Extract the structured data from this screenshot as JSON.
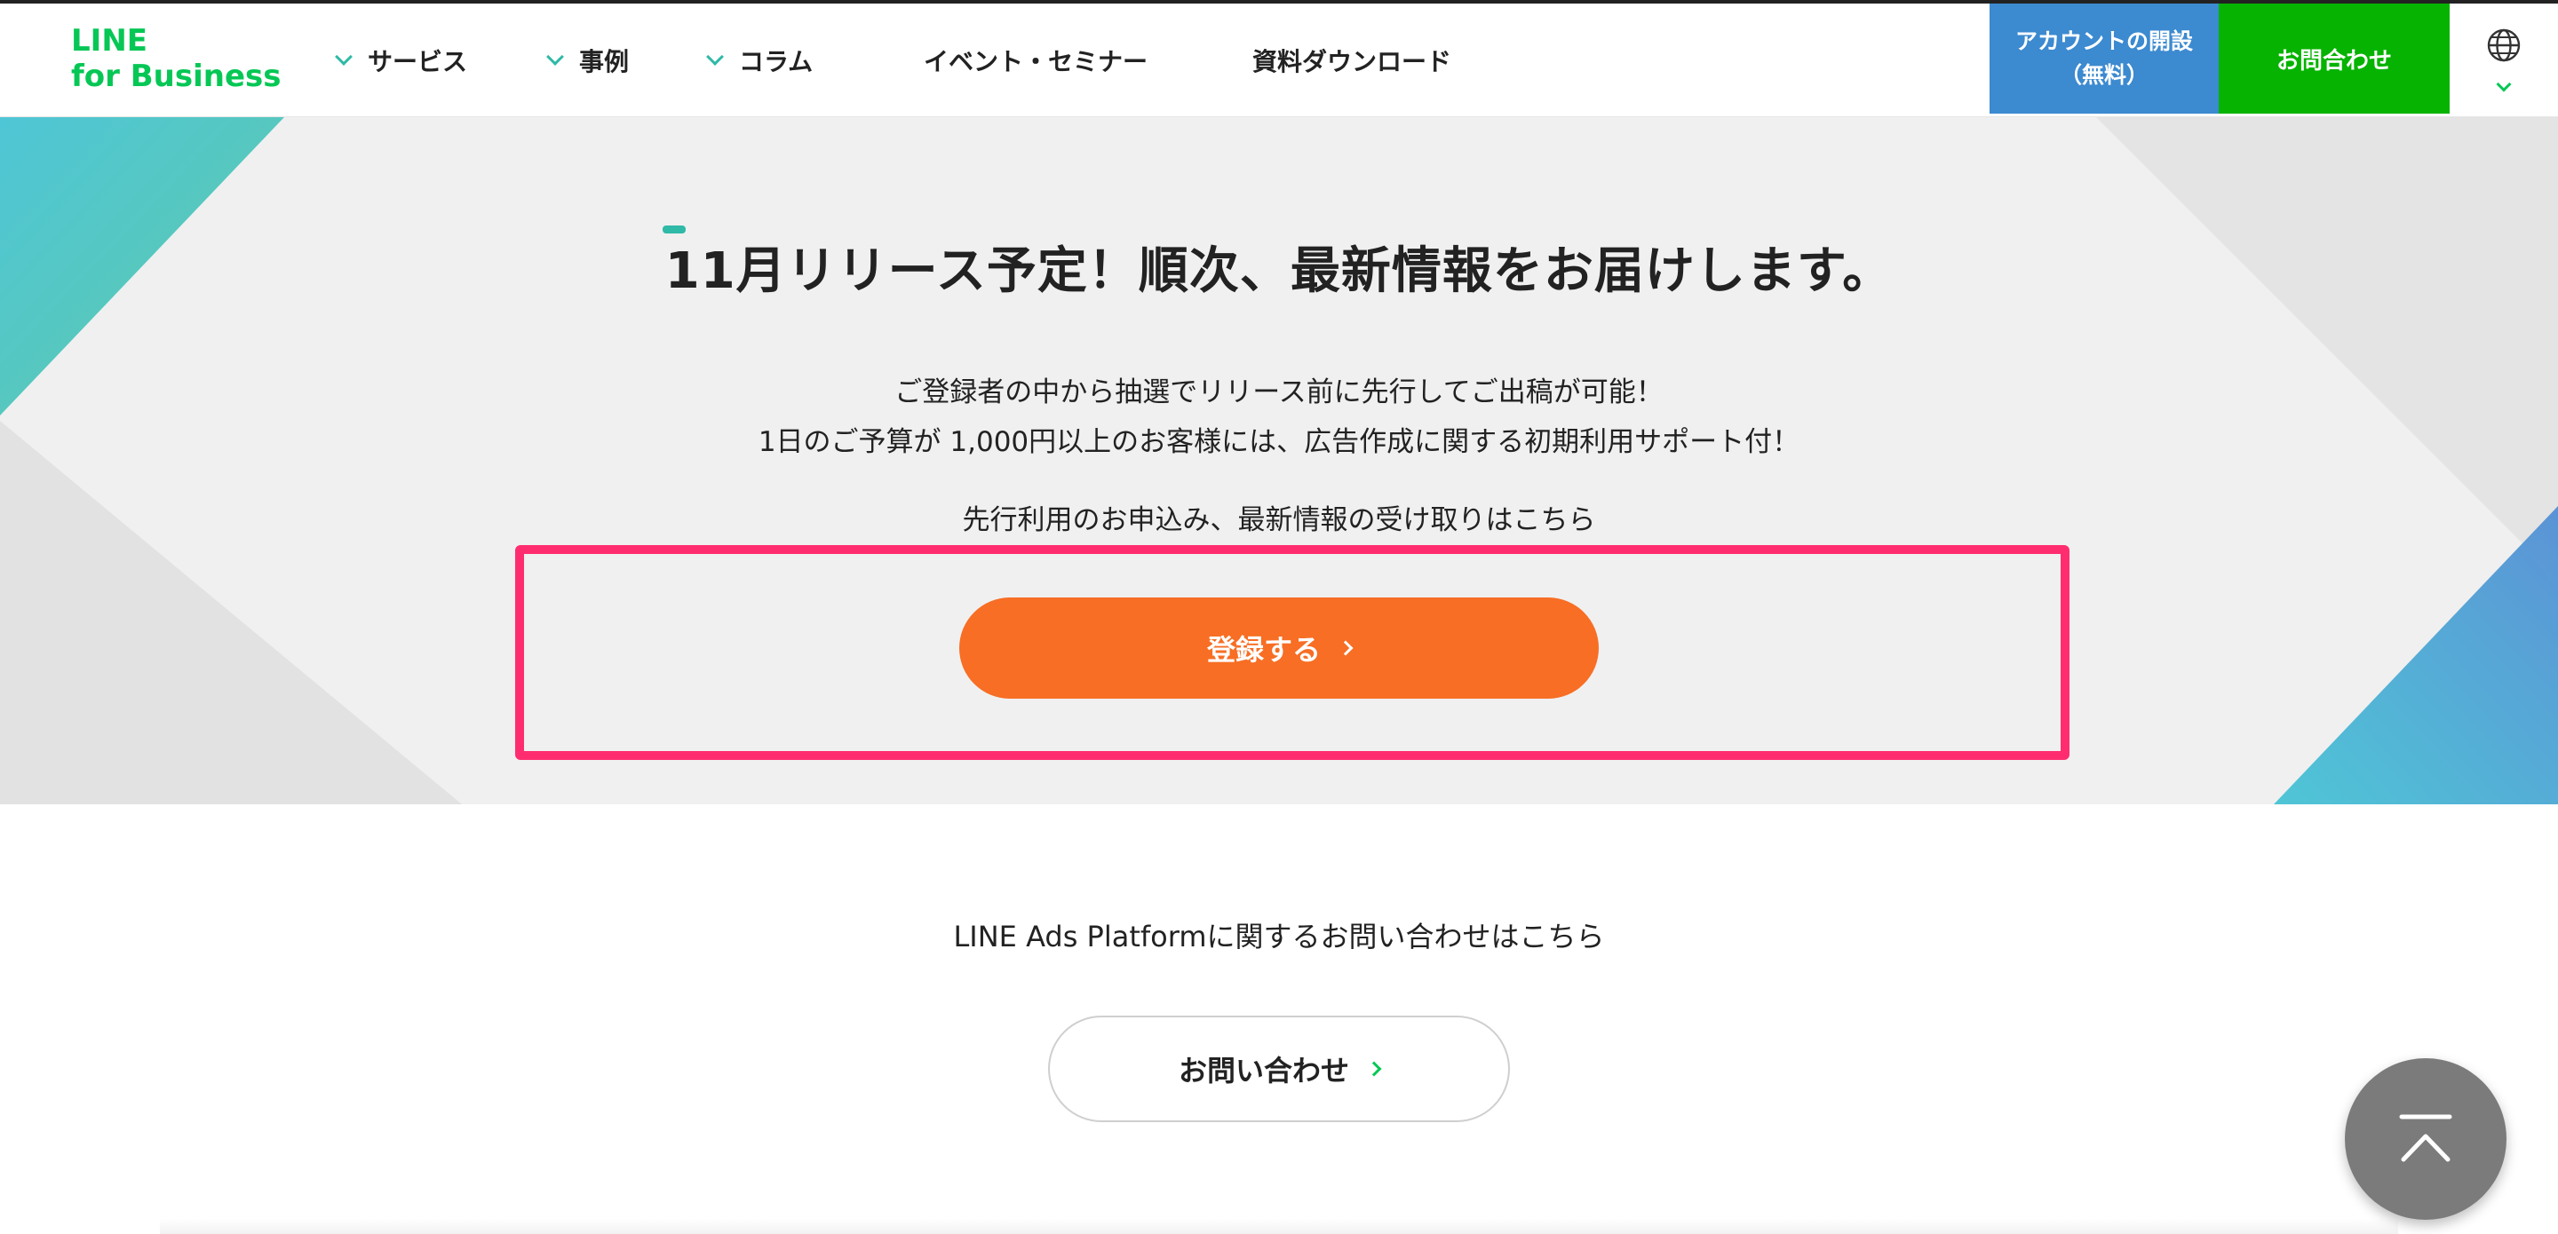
{
  "header": {
    "logo_line1": "LINE",
    "logo_line2": "for Business",
    "nav": [
      {
        "label": "サービス",
        "has_dropdown": true
      },
      {
        "label": "事例",
        "has_dropdown": true
      },
      {
        "label": "コラム",
        "has_dropdown": true
      },
      {
        "label": "イベント・セミナー",
        "has_dropdown": false
      },
      {
        "label": "資料ダウンロード",
        "has_dropdown": false
      }
    ],
    "account_button": {
      "line1": "アカウントの開設",
      "line2": "（無料）"
    },
    "contact_button": "お問合わせ",
    "language_icon": "globe-icon"
  },
  "hero": {
    "title": "11月リリース予定！順次、最新情報をお届けします。",
    "desc_line1": "ご登録者の中から抽選でリリース前に先行してご出稿が可能！",
    "desc_line2": "1日のご予算が 1,000円以上のお客様には、広告作成に関する初期利用サポート付！",
    "desc_line3": "先行利用のお申込み、最新情報の受け取りはこちら",
    "register_button": "登録する"
  },
  "inquiry": {
    "text": "LINE Ads Platformに関するお問い合わせはこちら",
    "button": "お問い合わせ"
  },
  "colors": {
    "line_green": "#06c755",
    "account_blue": "#3c8ad0",
    "contact_green": "#06b300",
    "register_orange": "#f76e24",
    "highlight_pink": "#ff2d6f",
    "teal_accent": "#2fb9a7"
  },
  "icons": {
    "scroll_top": "arrow-up-icon",
    "nav_chevron": "chevron-down-icon",
    "button_arrow": "chevron-right-icon"
  }
}
